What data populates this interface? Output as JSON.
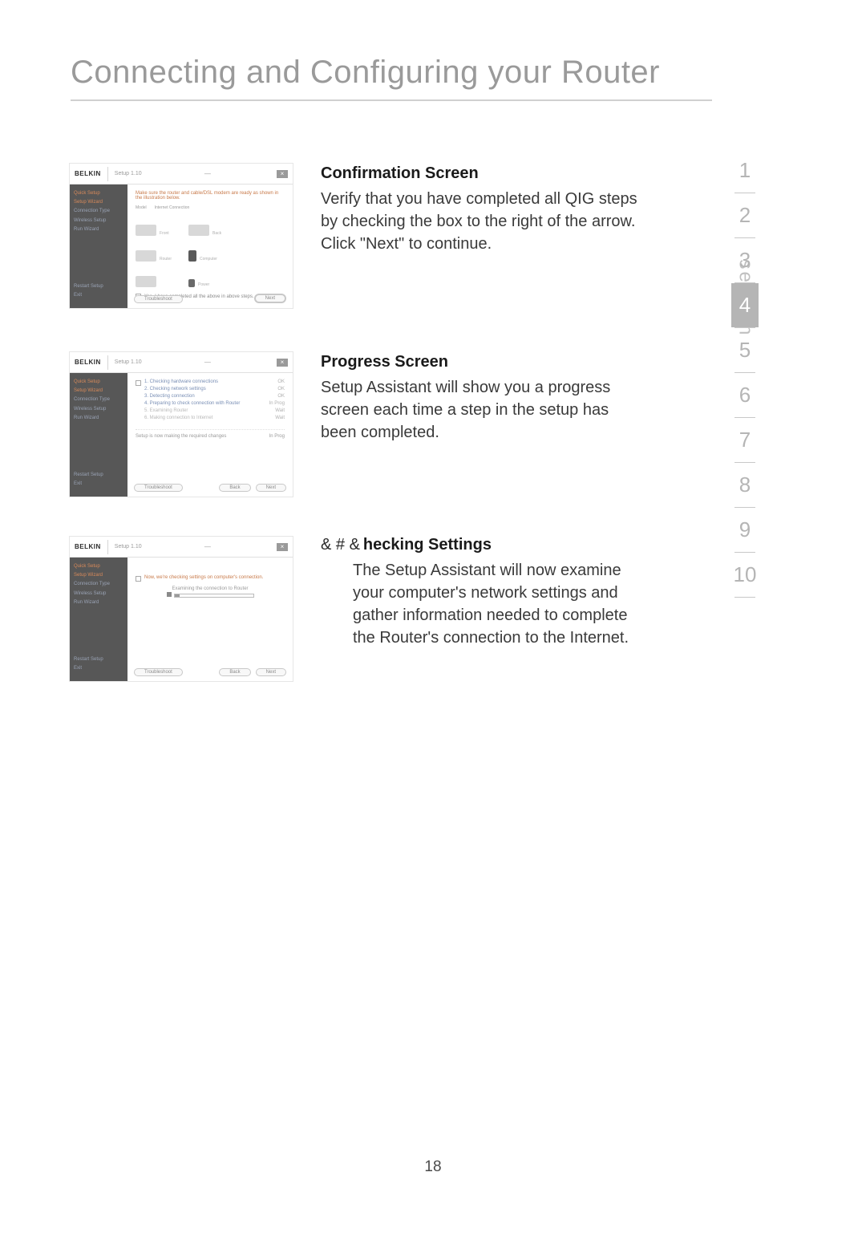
{
  "page_title": "Connecting and Configuring your Router",
  "page_number": "18",
  "section_label": "section",
  "nav": {
    "items": [
      "1",
      "2",
      "3",
      "4",
      "5",
      "6",
      "7",
      "8",
      "9",
      "10"
    ],
    "active_index": 3
  },
  "blocks": {
    "confirmation": {
      "heading": "Confirmation Screen",
      "body": "Verify that you have completed all QIG steps by checking the box to the right of the arrow. Click \"Next\" to continue."
    },
    "progress": {
      "heading": "Progress Screen",
      "body": "Setup Assistant will show you a progress screen each time a step in the setup has been completed."
    },
    "checking": {
      "prefix": "& # &",
      "heading": "hecking Settings",
      "body": "The Setup Assistant will now examine your computer's network settings and gather information needed to complete the Router's connection to the Internet."
    }
  },
  "screenshot_common": {
    "logo": "BELKIN",
    "subtitle": "Setup 1.10",
    "close": "×",
    "dash": "—",
    "sidebar": {
      "group1": [
        "Quick Setup",
        "Setup Wizard",
        "Connection Type",
        "Wireless Setup",
        "Run Wizard"
      ],
      "group2": [
        "Restart Setup",
        "Exit"
      ]
    }
  },
  "screenshot1": {
    "top_line": "Make sure the router and cable/DSL modem are ready as shown in the illustration below.",
    "check_text": "Yes, I have completed all the above in above steps.",
    "btn_left": "Troubleshoot",
    "btn_right": "Next"
  },
  "screenshot2": {
    "items": [
      {
        "txt": "1. Checking hardware connections",
        "status": "OK"
      },
      {
        "txt": "2. Checking network settings",
        "status": "OK"
      },
      {
        "txt": "3. Detecting connection",
        "status": "OK"
      },
      {
        "txt": "4. Preparing to check connection with Router",
        "status": "In Prog"
      },
      {
        "txt": "5. Examining Router",
        "status": "Wait"
      },
      {
        "txt": "6. Making connection to Internet",
        "status": "Wait"
      }
    ],
    "state_left": "Setup is now making the required changes",
    "state_right": "In Prog",
    "btn_left": "Troubleshoot",
    "btn_mid": "Back",
    "btn_right": "Next"
  },
  "screenshot3": {
    "top_line": "Now, we're checking settings on computer's connection.",
    "sub_line": "Examining the connection to Router",
    "btn_left": "Troubleshoot",
    "btn_mid": "Back",
    "btn_right": "Next"
  }
}
